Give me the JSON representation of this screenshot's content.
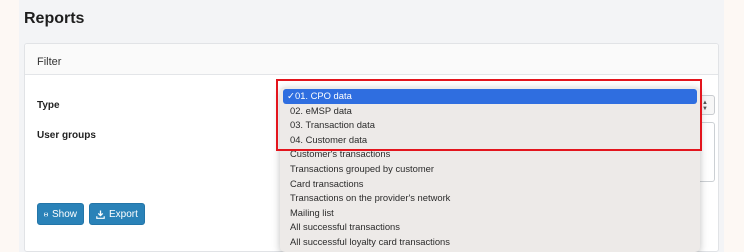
{
  "page": {
    "title": "Reports"
  },
  "filter": {
    "header": "Filter",
    "type_label": "Type",
    "groups_label": "User groups"
  },
  "buttons": {
    "show": "Show",
    "export": "Export"
  },
  "dropdown": {
    "check": "✓",
    "items": [
      "01. CPO data",
      "02. eMSP data",
      "03. Transaction data",
      "04. Customer data",
      "Customer's transactions",
      "Transactions grouped by customer",
      "Card transactions",
      "Transactions on the provider's network",
      "Mailing list",
      "All successful transactions",
      "All successful loyalty card transactions"
    ],
    "selected_index": 0
  },
  "colors": {
    "accent": "#2a82b8",
    "selection": "#2f6ee0",
    "highlight": "#e3151d"
  }
}
